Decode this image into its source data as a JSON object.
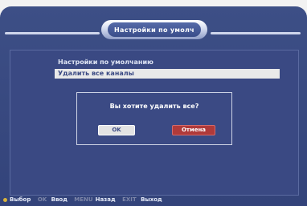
{
  "header": {
    "title": "Настройки по умолч"
  },
  "menu": {
    "items": [
      {
        "label": "Настройки по умолчанию"
      },
      {
        "label": "Удалить все каналы"
      }
    ]
  },
  "dialog": {
    "message": "Вы хотите удалить все?",
    "ok_label": "OK",
    "cancel_label": "Отмена"
  },
  "footer": {
    "select_label": "Выбор",
    "ok_key": "OK",
    "enter_label": "Ввод",
    "menu_key": "MENU",
    "back_label": "Назад",
    "exit_key": "EXIT",
    "exit_label": "Выход"
  },
  "colors": {
    "background": "#3b4a84",
    "highlight": "#e9e9e9",
    "cancel": "#b03a3a"
  },
  "icons": {
    "select": "yellow-dot-icon"
  }
}
